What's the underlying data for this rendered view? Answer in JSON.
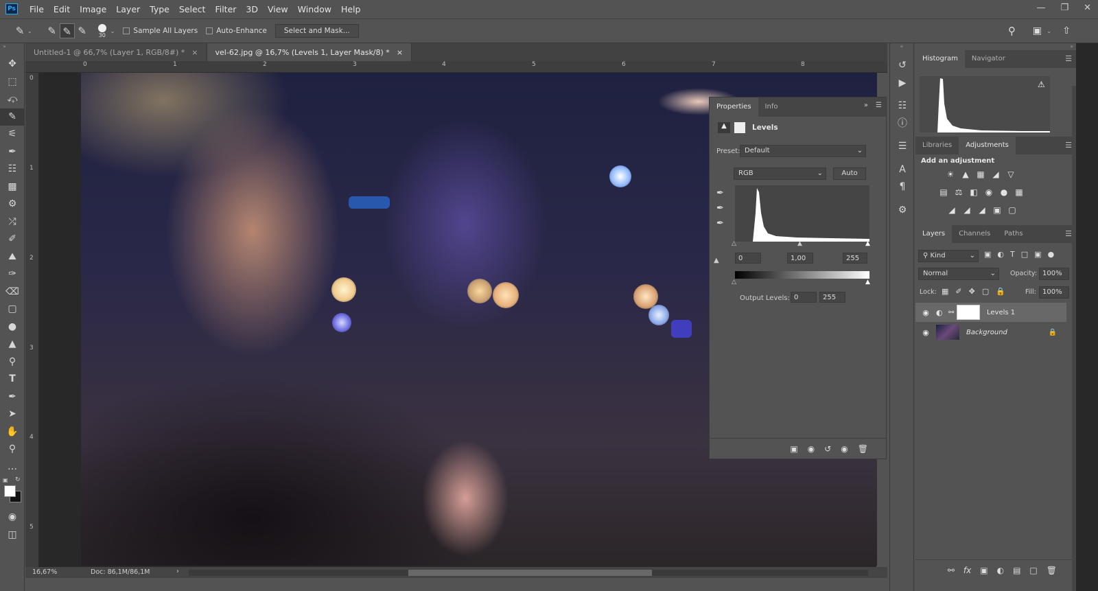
{
  "app": {
    "logo": "Ps"
  },
  "menu": [
    "File",
    "Edit",
    "Image",
    "Layer",
    "Type",
    "Select",
    "Filter",
    "3D",
    "View",
    "Window",
    "Help"
  ],
  "options": {
    "brush_size": "30",
    "sample_all_layers": "Sample All Layers",
    "auto_enhance": "Auto-Enhance",
    "select_mask": "Select and Mask..."
  },
  "tabs": [
    {
      "label": "Untitled-1 @ 66,7% (Layer 1, RGB/8#) *",
      "active": false
    },
    {
      "label": "vel-62.jpg @ 16,7% (Levels 1, Layer Mask/8) *",
      "active": true
    }
  ],
  "rulers": {
    "top": [
      "0",
      "1",
      "2",
      "3",
      "4",
      "5",
      "6",
      "7",
      "8"
    ],
    "left": [
      "0",
      "1",
      "2",
      "3",
      "4",
      "5"
    ]
  },
  "status": {
    "zoom": "16,67%",
    "doc": "Doc: 86,1M/86,1M"
  },
  "properties": {
    "tabs": [
      "Properties",
      "Info"
    ],
    "title": "Levels",
    "preset_label": "Preset:",
    "preset_value": "Default",
    "channel": "RGB",
    "auto": "Auto",
    "input_black": "0",
    "input_gamma": "1,00",
    "input_white": "255",
    "output_label": "Output Levels:",
    "output_black": "0",
    "output_white": "255"
  },
  "histogram_panel": {
    "tabs": [
      "Histogram",
      "Navigator"
    ]
  },
  "adjustments_panel": {
    "tabs": [
      "Libraries",
      "Adjustments"
    ],
    "add_label": "Add an adjustment"
  },
  "layers_panel": {
    "tabs": [
      "Layers",
      "Channels",
      "Paths"
    ],
    "kind": "Kind",
    "blend_mode": "Normal",
    "opacity_label": "Opacity:",
    "opacity_value": "100%",
    "lock_label": "Lock:",
    "fill_label": "Fill:",
    "fill_value": "100%",
    "layers": [
      {
        "name": "Levels 1",
        "type": "adjustment",
        "selected": true
      },
      {
        "name": "Background",
        "type": "image",
        "locked": true
      }
    ]
  }
}
